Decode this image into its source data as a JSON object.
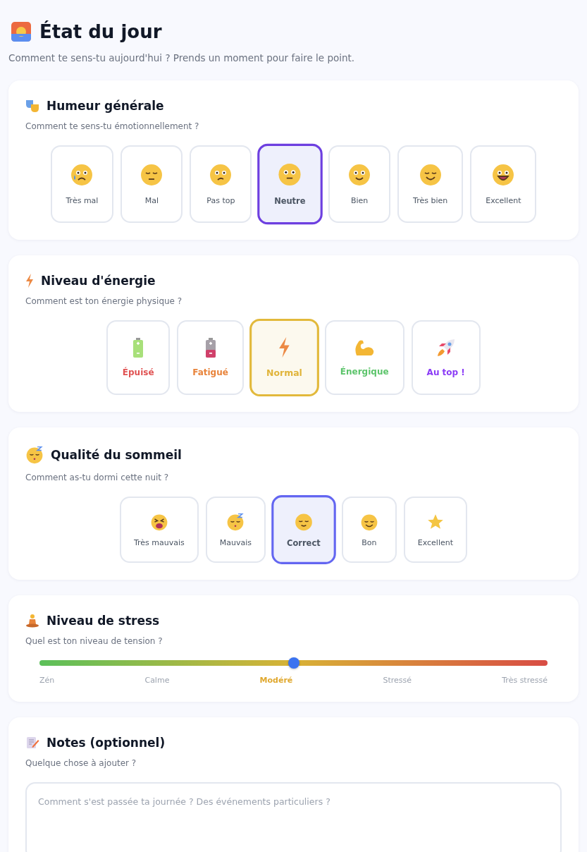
{
  "title": "État du jour",
  "subtitle": "Comment te sens-tu aujourd'hui ? Prends un moment pour faire le point.",
  "sections": [
    {
      "kind": "mood",
      "title": "Humeur générale",
      "subtitle": "Comment te sens-tu émotionnellement ?",
      "options": [
        {
          "label": "Très mal",
          "selected": false
        },
        {
          "label": "Mal",
          "selected": false
        },
        {
          "label": "Pas top",
          "selected": false
        },
        {
          "label": "Neutre",
          "selected": true
        },
        {
          "label": "Bien",
          "selected": false
        },
        {
          "label": "Très bien",
          "selected": false
        },
        {
          "label": "Excellent",
          "selected": false
        }
      ]
    },
    {
      "kind": "energy",
      "title": "Niveau d'énergie",
      "subtitle": "Comment est ton énergie physique ?",
      "options": [
        {
          "label": "Épuisé",
          "selected": false,
          "color": "#e05252"
        },
        {
          "label": "Fatigué",
          "selected": false,
          "color": "#e8833a"
        },
        {
          "label": "Normal",
          "selected": true,
          "color": "#e0b43a"
        },
        {
          "label": "Énergique",
          "selected": false,
          "color": "#5cc46b"
        },
        {
          "label": "Au top !",
          "selected": false,
          "color": "#8b3cf6"
        }
      ]
    },
    {
      "kind": "sleep",
      "title": "Qualité du sommeil",
      "subtitle": "Comment as-tu dormi cette nuit ?",
      "options": [
        {
          "label": "Très mauvais",
          "selected": false
        },
        {
          "label": "Mauvais",
          "selected": false
        },
        {
          "label": "Correct",
          "selected": true
        },
        {
          "label": "Bon",
          "selected": false
        },
        {
          "label": "Excellent",
          "selected": false
        }
      ]
    },
    {
      "kind": "stress",
      "title": "Niveau de stress",
      "subtitle": "Quel est ton niveau de tension ?",
      "level": 0.5,
      "labels": [
        {
          "label": "Zén",
          "selected": false
        },
        {
          "label": "Calme",
          "selected": false
        },
        {
          "label": "Modéré",
          "selected": true
        },
        {
          "label": "Stressé",
          "selected": false
        },
        {
          "label": "Très stressé",
          "selected": false
        }
      ]
    },
    {
      "kind": "notes",
      "title": "Notes (optionnel)",
      "subtitle": "Quelque chose à ajouter ?",
      "placeholder": "Comment s'est passée ta journée ? Des événements particuliers ?"
    }
  ]
}
